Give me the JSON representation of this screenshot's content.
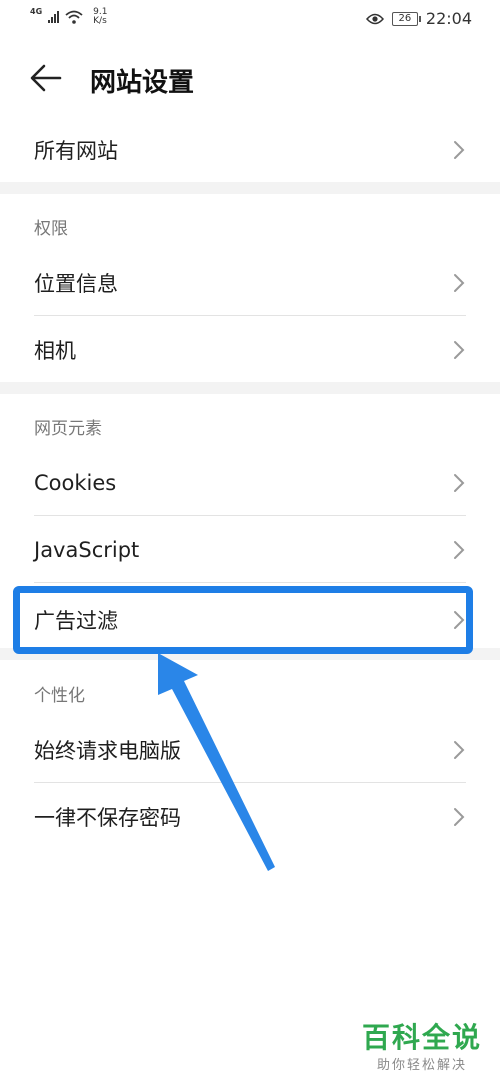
{
  "status_bar": {
    "network": "4G",
    "speed_value": "9.1",
    "speed_unit": "K/s",
    "battery": "26",
    "time": "22:04"
  },
  "header": {
    "title": "网站设置"
  },
  "list": {
    "all_sites": "所有网站",
    "permissions_label": "权限",
    "location": "位置信息",
    "camera": "相机",
    "page_elements_label": "网页元素",
    "cookies": "Cookies",
    "javascript": "JavaScript",
    "ad_filter": "广告过滤",
    "personalization_label": "个性化",
    "desktop_version": "始终请求电脑版",
    "never_save_password": "一律不保存密码"
  },
  "colors": {
    "highlight": "#1e7ee6",
    "arrow": "#2a86e8",
    "watermark": "#2fa84f"
  },
  "watermark": {
    "main": "百科全说",
    "sub": "助你轻松解决"
  }
}
